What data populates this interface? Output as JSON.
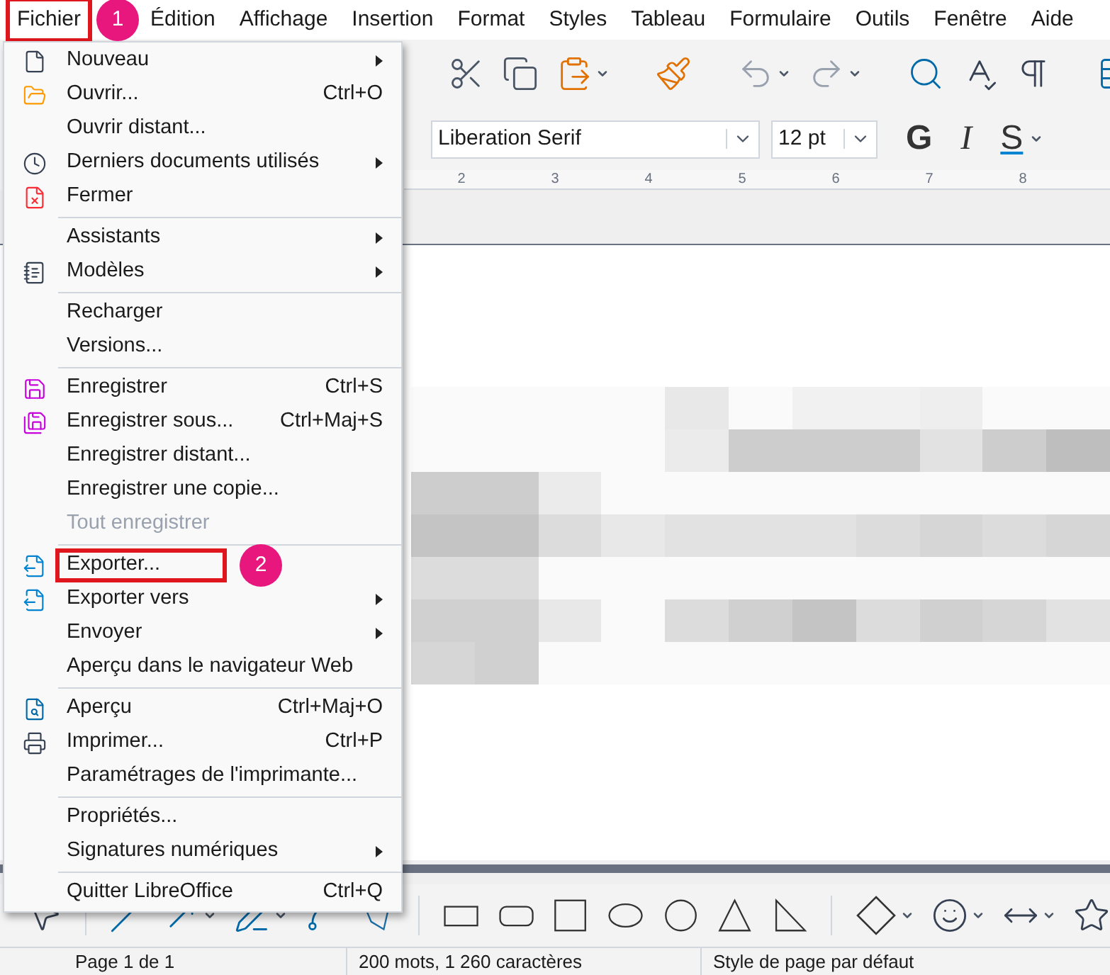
{
  "menubar": [
    {
      "label": "Fichier",
      "callout": "1"
    },
    {
      "label": "Édition"
    },
    {
      "label": "Affichage"
    },
    {
      "label": "Insertion"
    },
    {
      "label": "Format"
    },
    {
      "label": "Styles"
    },
    {
      "label": "Tableau"
    },
    {
      "label": "Formulaire"
    },
    {
      "label": "Outils"
    },
    {
      "label": "Fenêtre"
    },
    {
      "label": "Aide"
    }
  ],
  "formatting_bar": {
    "font_name": "Liberation Serif",
    "font_size": "12 pt",
    "style_buttons": [
      "G",
      "I",
      "S"
    ]
  },
  "ruler": {
    "labels": [
      "2",
      "3",
      "4",
      "5",
      "6",
      "7",
      "8"
    ]
  },
  "file_menu": [
    {
      "kind": "item",
      "label": "Nouveau",
      "submenu": true,
      "disabled": false
    },
    {
      "kind": "item",
      "label": "Ouvrir...",
      "shortcut": "Ctrl+O",
      "submenu": false,
      "disabled": false
    },
    {
      "kind": "item",
      "label": "Ouvrir distant...",
      "submenu": false,
      "disabled": false
    },
    {
      "kind": "item",
      "label": "Derniers documents utilisés",
      "submenu": true,
      "disabled": false
    },
    {
      "kind": "item",
      "label": "Fermer",
      "submenu": false,
      "disabled": false
    },
    {
      "kind": "separator"
    },
    {
      "kind": "item",
      "label": "Assistants",
      "submenu": true,
      "disabled": false
    },
    {
      "kind": "item",
      "label": "Modèles",
      "submenu": true,
      "disabled": false
    },
    {
      "kind": "separator"
    },
    {
      "kind": "item",
      "label": "Recharger",
      "submenu": false,
      "disabled": false
    },
    {
      "kind": "item",
      "label": "Versions...",
      "submenu": false,
      "disabled": false
    },
    {
      "kind": "separator"
    },
    {
      "kind": "item",
      "label": "Enregistrer",
      "shortcut": "Ctrl+S",
      "submenu": false,
      "disabled": false
    },
    {
      "kind": "item",
      "label": "Enregistrer sous...",
      "shortcut": "Ctrl+Maj+S",
      "submenu": false,
      "disabled": false
    },
    {
      "kind": "item",
      "label": "Enregistrer distant...",
      "submenu": false,
      "disabled": false
    },
    {
      "kind": "item",
      "label": "Enregistrer une copie...",
      "submenu": false,
      "disabled": false
    },
    {
      "kind": "item",
      "label": "Tout enregistrer",
      "submenu": false,
      "disabled": true
    },
    {
      "kind": "separator"
    },
    {
      "kind": "item",
      "label": "Exporter...",
      "submenu": false,
      "disabled": false,
      "callout": "2"
    },
    {
      "kind": "item",
      "label": "Exporter vers",
      "submenu": true,
      "disabled": false
    },
    {
      "kind": "item",
      "label": "Envoyer",
      "submenu": true,
      "disabled": false
    },
    {
      "kind": "item",
      "label": "Aperçu dans le navigateur Web",
      "submenu": false,
      "disabled": false
    },
    {
      "kind": "separator"
    },
    {
      "kind": "item",
      "label": "Aperçu",
      "shortcut": "Ctrl+Maj+O",
      "submenu": false,
      "disabled": false
    },
    {
      "kind": "item",
      "label": "Imprimer...",
      "shortcut": "Ctrl+P",
      "submenu": false,
      "disabled": false
    },
    {
      "kind": "item",
      "label": "Paramétrages de l'imprimante...",
      "submenu": false,
      "disabled": false
    },
    {
      "kind": "separator"
    },
    {
      "kind": "item",
      "label": "Propriétés...",
      "submenu": false,
      "disabled": false
    },
    {
      "kind": "item",
      "label": "Signatures numériques",
      "submenu": true,
      "disabled": false
    },
    {
      "kind": "separator"
    },
    {
      "kind": "item",
      "label": "Quitter LibreOffice",
      "shortcut": "Ctrl+Q",
      "submenu": false,
      "disabled": false
    }
  ],
  "status_bar": [
    "Page 1 de 1",
    "200 mots, 1 260 caractères",
    "Style de page par défaut"
  ]
}
